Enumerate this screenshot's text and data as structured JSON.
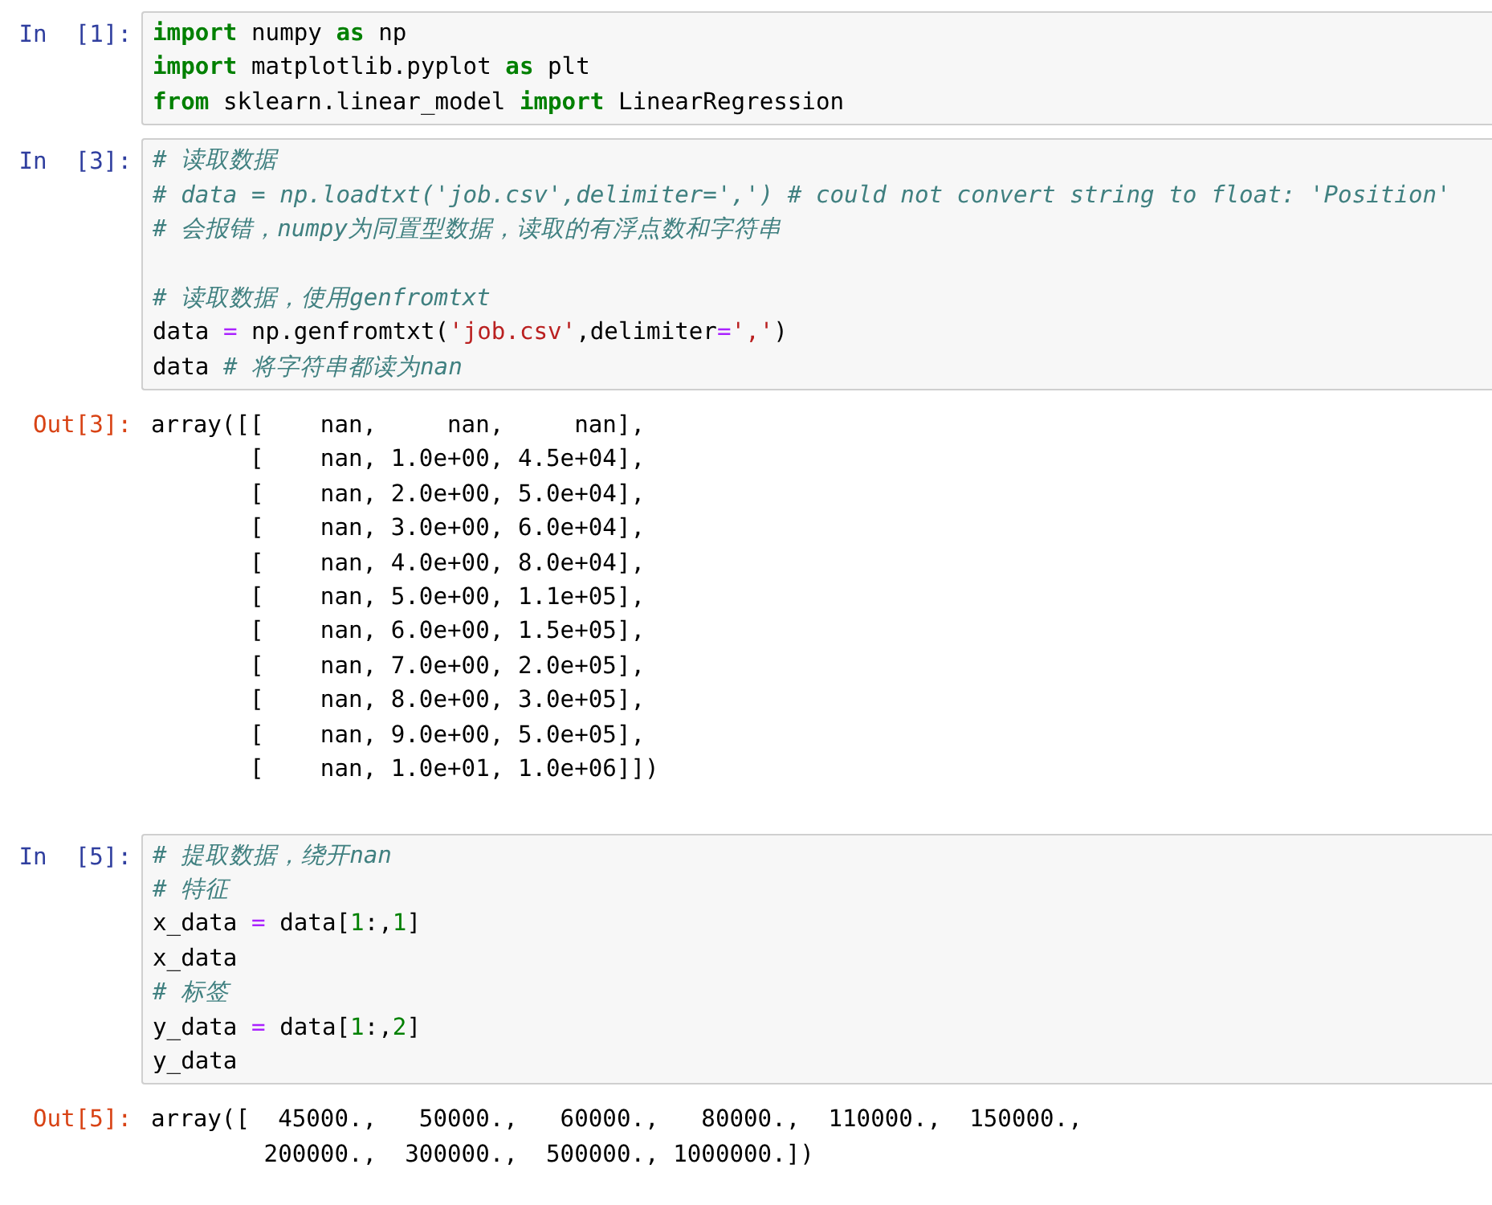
{
  "cells": [
    {
      "kind": "input",
      "prompt": "In  [1]:",
      "lines": [
        {
          "tokens": [
            {
              "kind": "kw",
              "t": "import"
            },
            {
              "kind": "plain",
              "t": " numpy "
            },
            {
              "kind": "kw",
              "t": "as"
            },
            {
              "kind": "plain",
              "t": " np"
            }
          ]
        },
        {
          "tokens": [
            {
              "kind": "kw",
              "t": "import"
            },
            {
              "kind": "plain",
              "t": " matplotlib.pyplot "
            },
            {
              "kind": "kw",
              "t": "as"
            },
            {
              "kind": "plain",
              "t": " plt"
            }
          ]
        },
        {
          "tokens": [
            {
              "kind": "kw",
              "t": "from"
            },
            {
              "kind": "plain",
              "t": " sklearn.linear_model "
            },
            {
              "kind": "kw",
              "t": "import"
            },
            {
              "kind": "plain",
              "t": " LinearRegression"
            }
          ]
        }
      ]
    },
    {
      "kind": "input",
      "prompt": "In  [3]:",
      "lines": [
        {
          "tokens": [
            {
              "kind": "cm",
              "t": "# 读取数据"
            }
          ]
        },
        {
          "tokens": [
            {
              "kind": "cm",
              "t": "# data = np.loadtxt('job.csv',delimiter=',') # could not convert string to float: 'Position'"
            }
          ]
        },
        {
          "tokens": [
            {
              "kind": "cm",
              "t": "# 会报错，numpy为同置型数据，读取的有浮点数和字符串"
            }
          ]
        },
        {
          "spaced": true,
          "tokens": [
            {
              "kind": "cm",
              "t": "# 读取数据，使用genfromtxt"
            }
          ]
        },
        {
          "tokens": [
            {
              "kind": "plain",
              "t": "data "
            },
            {
              "kind": "op",
              "t": "="
            },
            {
              "kind": "plain",
              "t": " np.genfromtxt("
            },
            {
              "kind": "str",
              "t": "'job.csv'"
            },
            {
              "kind": "plain",
              "t": ",delimiter"
            },
            {
              "kind": "op",
              "t": "="
            },
            {
              "kind": "str",
              "t": "','"
            },
            {
              "kind": "plain",
              "t": ")"
            }
          ]
        },
        {
          "tokens": [
            {
              "kind": "plain",
              "t": "data "
            },
            {
              "kind": "cm",
              "t": "# 将字符串都读为nan"
            }
          ]
        }
      ]
    },
    {
      "kind": "output",
      "prompt": "Out[3]:",
      "lines": [
        "array([[    nan,     nan,     nan],",
        "       [    nan, 1.0e+00, 4.5e+04],",
        "       [    nan, 2.0e+00, 5.0e+04],",
        "       [    nan, 3.0e+00, 6.0e+04],",
        "       [    nan, 4.0e+00, 8.0e+04],",
        "       [    nan, 5.0e+00, 1.1e+05],",
        "       [    nan, 6.0e+00, 1.5e+05],",
        "       [    nan, 7.0e+00, 2.0e+05],",
        "       [    nan, 8.0e+00, 3.0e+05],",
        "       [    nan, 9.0e+00, 5.0e+05],",
        "       [    nan, 1.0e+01, 1.0e+06]])"
      ]
    },
    {
      "kind": "input",
      "prompt": "In  [5]:",
      "lines": [
        {
          "tokens": [
            {
              "kind": "cm",
              "t": "# 提取数据，绕开nan"
            }
          ]
        },
        {
          "tokens": [
            {
              "kind": "cm",
              "t": "# 特征"
            }
          ]
        },
        {
          "tokens": [
            {
              "kind": "plain",
              "t": "x_data "
            },
            {
              "kind": "op",
              "t": "="
            },
            {
              "kind": "plain",
              "t": " data["
            },
            {
              "kind": "num",
              "t": "1"
            },
            {
              "kind": "plain",
              "t": ":,"
            },
            {
              "kind": "num",
              "t": "1"
            },
            {
              "kind": "plain",
              "t": "]"
            }
          ]
        },
        {
          "tokens": [
            {
              "kind": "plain",
              "t": "x_data"
            }
          ]
        },
        {
          "tokens": [
            {
              "kind": "cm",
              "t": "# 标签"
            }
          ]
        },
        {
          "tokens": [
            {
              "kind": "plain",
              "t": "y_data "
            },
            {
              "kind": "op",
              "t": "="
            },
            {
              "kind": "plain",
              "t": " data["
            },
            {
              "kind": "num",
              "t": "1"
            },
            {
              "kind": "plain",
              "t": ":,"
            },
            {
              "kind": "num",
              "t": "2"
            },
            {
              "kind": "plain",
              "t": "]"
            }
          ]
        },
        {
          "tokens": [
            {
              "kind": "plain",
              "t": "y_data"
            }
          ]
        }
      ]
    },
    {
      "kind": "output",
      "prompt": "Out[5]:",
      "lines": [
        "array([  45000.,   50000.,   60000.,   80000.,  110000.,  150000.,",
        "        200000.,  300000.,  500000., 1000000.])"
      ]
    }
  ]
}
